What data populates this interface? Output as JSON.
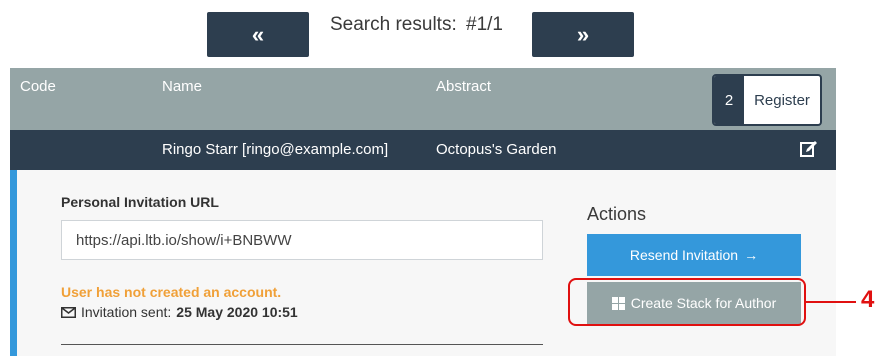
{
  "pager": {
    "prev_label": "«",
    "next_label": "»",
    "status_label": "Search results:",
    "status_value": "#1/1"
  },
  "table": {
    "headers": {
      "code": "Code",
      "name": "Name",
      "abstract": "Abstract"
    },
    "register_button": {
      "count": "2",
      "label": "Register"
    },
    "row": {
      "code": "",
      "name": "Ringo Starr [ringo@example.com]",
      "abstract": "Octopus's Garden",
      "edit_icon": "edit-icon"
    }
  },
  "detail": {
    "invitation_url_label": "Personal Invitation URL",
    "invitation_url_value": "https://api.ltb.io/show/i+BNBWW",
    "warning": "User has not created an account.",
    "sent_label": "Invitation sent:",
    "sent_date": "25 May 2020 10:51",
    "actions_title": "Actions",
    "resend_button": "Resend Invitation",
    "create_stack_button": "Create Stack for Author"
  },
  "annotation": {
    "number": "4"
  },
  "colors": {
    "dark": "#2d3e4f",
    "header_gray": "#95a5a6",
    "accent_blue": "#3498db",
    "warning_orange": "#f0a038",
    "annotation_red": "#e01010"
  }
}
